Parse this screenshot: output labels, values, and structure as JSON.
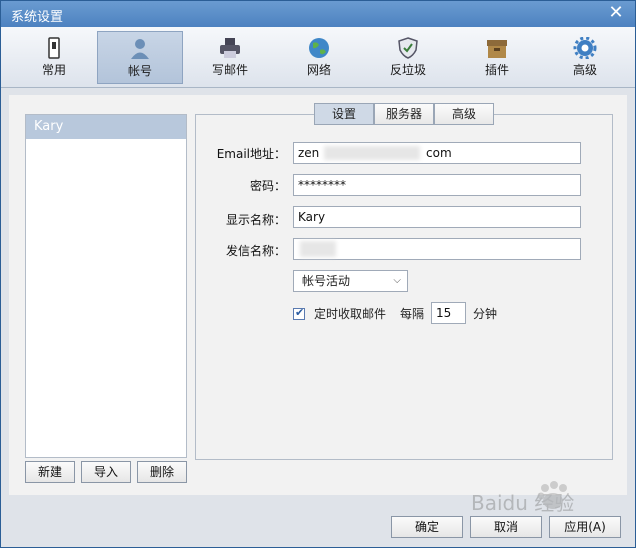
{
  "window": {
    "title": "系统设置"
  },
  "toolbar": {
    "items": [
      {
        "label": "常用",
        "icon": "phone-icon"
      },
      {
        "label": "帐号",
        "icon": "user-icon"
      },
      {
        "label": "写邮件",
        "icon": "printer-icon"
      },
      {
        "label": "网络",
        "icon": "globe-icon"
      },
      {
        "label": "反垃圾",
        "icon": "shield-icon"
      },
      {
        "label": "插件",
        "icon": "box-icon"
      },
      {
        "label": "高级",
        "icon": "gear-icon"
      }
    ],
    "active": "帐号"
  },
  "accounts": {
    "items": [
      {
        "name": "Kary"
      }
    ]
  },
  "account_buttons": {
    "new": "新建",
    "import": "导入",
    "delete": "删除"
  },
  "tabs": [
    {
      "label": "设置"
    },
    {
      "label": "服务器"
    },
    {
      "label": "高级"
    }
  ],
  "form": {
    "email_label": "Email地址：",
    "email_value_start": "zen",
    "email_value_end": "com",
    "password_label": "密码：",
    "password_value": "********",
    "display_name_label": "显示名称：",
    "display_name_value": "Kary",
    "sender_name_label": "发信名称：",
    "status_select": "帐号活动",
    "auto_fetch_label": "定时收取邮件",
    "auto_fetch_checked": true,
    "interval_prefix": "每隔",
    "interval_value": "15",
    "interval_unit": "分钟"
  },
  "footer": {
    "ok": "确定",
    "cancel": "取消",
    "apply": "应用(A)"
  },
  "watermark": {
    "text": "Baidu 经验"
  }
}
